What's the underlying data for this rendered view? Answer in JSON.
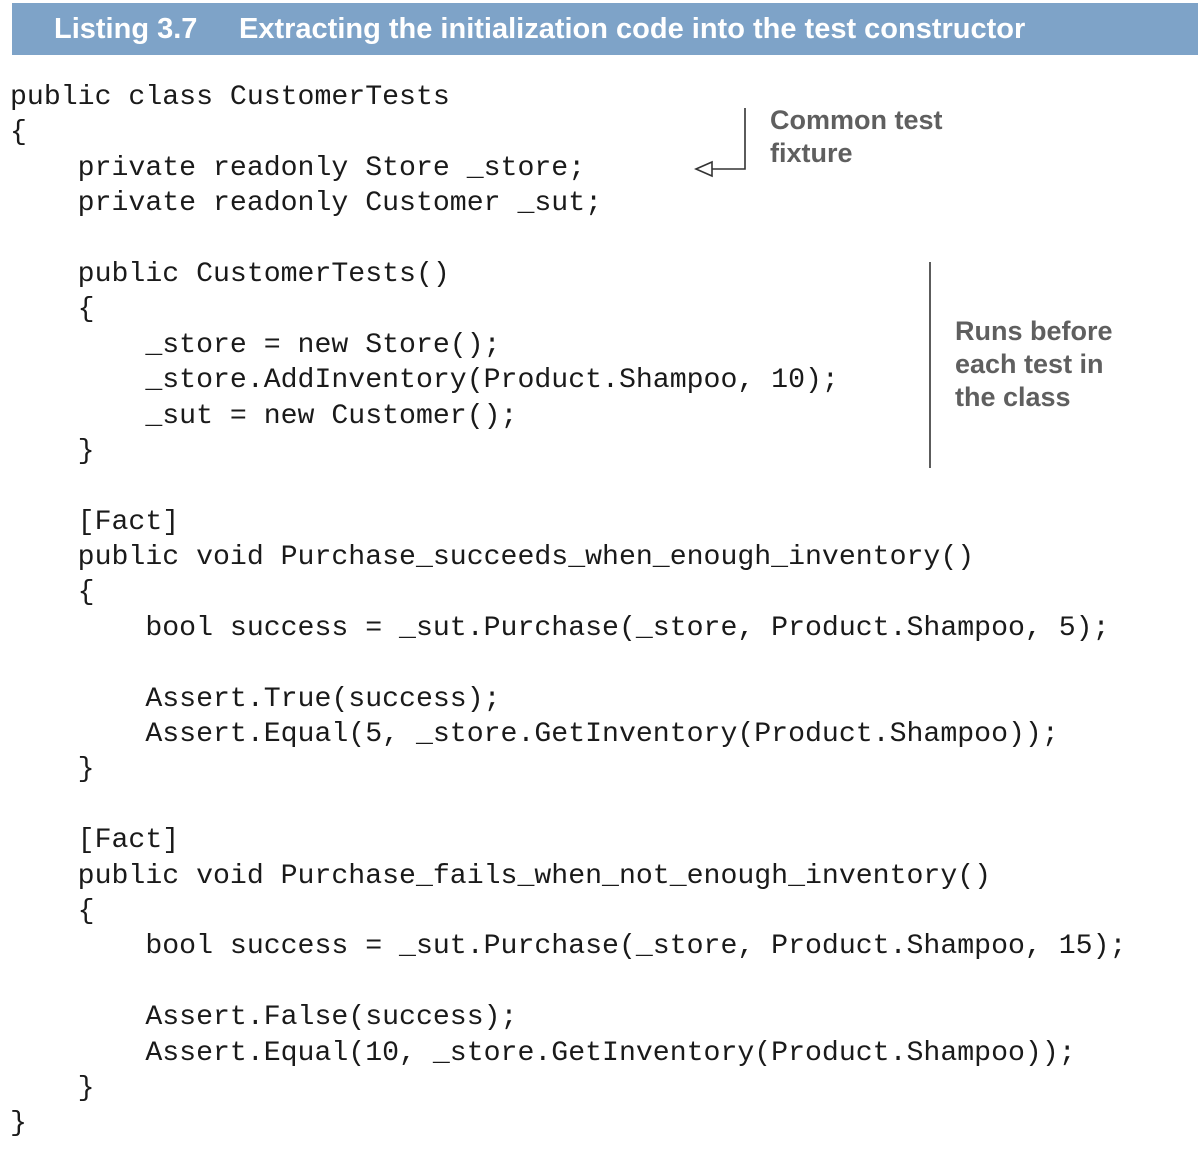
{
  "listing": {
    "number": "Listing 3.7",
    "title": "Extracting the initialization code into the test constructor"
  },
  "code_lines": [
    "public class CustomerTests",
    "{",
    "    private readonly Store _store;",
    "    private readonly Customer _sut;",
    "",
    "    public CustomerTests()",
    "    {",
    "        _store = new Store();",
    "        _store.AddInventory(Product.Shampoo, 10);",
    "        _sut = new Customer();",
    "    }",
    "",
    "    [Fact]",
    "    public void Purchase_succeeds_when_enough_inventory()",
    "    {",
    "        bool success = _sut.Purchase(_store, Product.Shampoo, 5);",
    "",
    "        Assert.True(success);",
    "        Assert.Equal(5, _store.GetInventory(Product.Shampoo));",
    "    }",
    "",
    "    [Fact]",
    "    public void Purchase_fails_when_not_enough_inventory()",
    "    {",
    "        bool success = _sut.Purchase(_store, Product.Shampoo, 15);",
    "",
    "        Assert.False(success);",
    "        Assert.Equal(10, _store.GetInventory(Product.Shampoo));",
    "    }",
    "}"
  ],
  "annotations": {
    "fixture": "Common test\nfixture",
    "constructor": "Runs before\neach test in\nthe class"
  }
}
